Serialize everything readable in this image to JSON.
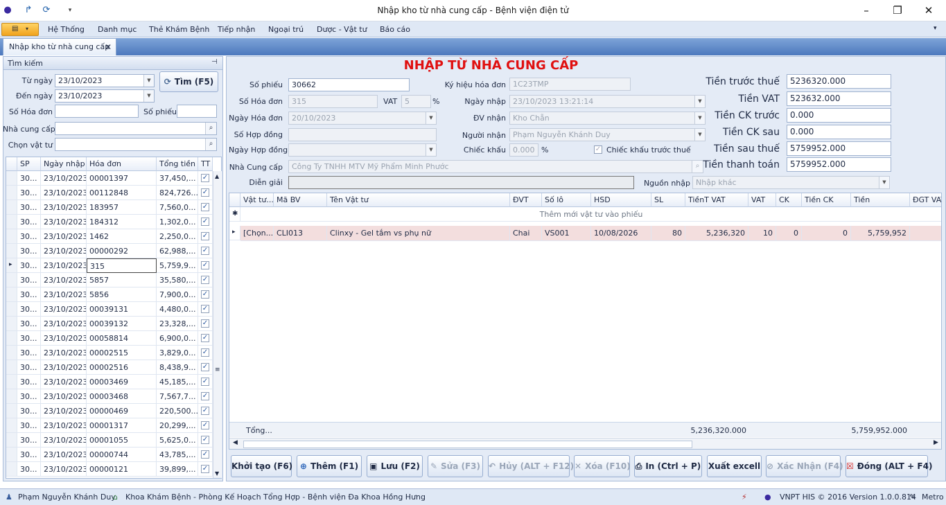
{
  "window": {
    "title": "Nhập kho từ nhà cung cấp - Bệnh viện điện tử"
  },
  "menu": [
    "Hệ Thống",
    "Danh mục",
    "Thẻ Khám Bệnh",
    "Tiếp nhận",
    "Ngoại trú",
    "Dược - Vật tư",
    "Báo cáo"
  ],
  "tab": {
    "label": "Nhập kho từ nhà cung cấp"
  },
  "search": {
    "header": "Tìm kiếm",
    "from_label": "Từ ngày",
    "from_value": "23/10/2023",
    "to_label": "Đến ngày",
    "to_value": "23/10/2023",
    "invoice_label": "Số Hóa đơn",
    "invoice_value": "",
    "slip_label": "Số phiếu",
    "slip_value": "",
    "supplier_label": "Nhà cung cấp",
    "supplier_value": "",
    "material_label": "Chọn vật tư",
    "material_value": "",
    "find_button": "Tìm (F5)"
  },
  "list": {
    "columns": [
      "SP",
      "Ngày nhập",
      "Hóa đơn",
      "Tổng tiền",
      "TT"
    ],
    "rows": [
      {
        "sp": "30...",
        "date": "23/10/2023",
        "invoice": "00001397",
        "total": "37,450,..."
      },
      {
        "sp": "30...",
        "date": "23/10/2023",
        "invoice": "00112848",
        "total": "824,726...."
      },
      {
        "sp": "30...",
        "date": "23/10/2023",
        "invoice": "183957",
        "total": "7,560,0..."
      },
      {
        "sp": "30...",
        "date": "23/10/2023",
        "invoice": "184312",
        "total": "1,302,0..."
      },
      {
        "sp": "30...",
        "date": "23/10/2023",
        "invoice": "1462",
        "total": "2,250,0..."
      },
      {
        "sp": "30...",
        "date": "23/10/2023",
        "invoice": "00000292",
        "total": "62,988,..."
      },
      {
        "sp": "30...",
        "date": "23/10/2023",
        "invoice": "315",
        "total": "5,759,9..."
      },
      {
        "sp": "30...",
        "date": "23/10/2023",
        "invoice": "5857",
        "total": "35,580,..."
      },
      {
        "sp": "30...",
        "date": "23/10/2023",
        "invoice": "5856",
        "total": "7,900,0..."
      },
      {
        "sp": "30...",
        "date": "23/10/2023",
        "invoice": "00039131",
        "total": "4,480,0..."
      },
      {
        "sp": "30...",
        "date": "23/10/2023",
        "invoice": "00039132",
        "total": "23,328,..."
      },
      {
        "sp": "30...",
        "date": "23/10/2023",
        "invoice": "00058814",
        "total": "6,900,0..."
      },
      {
        "sp": "30...",
        "date": "23/10/2023",
        "invoice": "00002515",
        "total": "3,829,0..."
      },
      {
        "sp": "30...",
        "date": "23/10/2023",
        "invoice": "00002516",
        "total": "8,438,9..."
      },
      {
        "sp": "30...",
        "date": "23/10/2023",
        "invoice": "00003469",
        "total": "45,185,..."
      },
      {
        "sp": "30...",
        "date": "23/10/2023",
        "invoice": "00003468",
        "total": "7,567,7..."
      },
      {
        "sp": "30...",
        "date": "23/10/2023",
        "invoice": "00000469",
        "total": "220,500..."
      },
      {
        "sp": "30...",
        "date": "23/10/2023",
        "invoice": "00001317",
        "total": "20,299,..."
      },
      {
        "sp": "30...",
        "date": "23/10/2023",
        "invoice": "00001055",
        "total": "5,625,0..."
      },
      {
        "sp": "30...",
        "date": "23/10/2023",
        "invoice": "00000744",
        "total": "43,785,..."
      },
      {
        "sp": "30...",
        "date": "23/10/2023",
        "invoice": "00000121",
        "total": "39,899,..."
      }
    ]
  },
  "form": {
    "title": "NHẬP TỪ NHÀ CUNG CẤP",
    "slip_label": "Số phiếu",
    "slip_value": "30662",
    "invoice_label": "Số Hóa đơn",
    "invoice_value": "315",
    "vat_label": "VAT",
    "vat_value": "5",
    "vat_unit": "%",
    "invoice_date_label": "Ngày Hóa đơn",
    "invoice_date_value": "20/10/2023",
    "contract_label": "Số Hợp đồng",
    "contract_value": "",
    "contract_date_label": "Ngày Hợp đồng",
    "contract_date_value": "",
    "supplier_label": "Nhà Cung cấp",
    "supplier_value": "Công Ty TNHH MTV Mỹ Phẩm Minh Phước",
    "note_label": "Diễn giải",
    "note_value": "",
    "symbol_label": "Ký hiệu hóa đơn",
    "symbol_value": "1C23TMP",
    "import_date_label": "Ngày nhập",
    "import_date_value": "23/10/2023 13:21:14",
    "dept_label": "ĐV nhận",
    "dept_value": "Kho Chẵn",
    "receiver_label": "Người nhận",
    "receiver_value": "Phạm Nguyễn  Khánh Duy",
    "discount_label": "Chiếc khấu",
    "discount_value": "0.000",
    "discount_unit": "%",
    "discount_before_tax_label": "Chiếc khấu trước thuế",
    "source_label": "Nguồn nhập",
    "source_value": "Nhập khác"
  },
  "summary": {
    "before_tax_label": "Tiền trước thuế",
    "before_tax_value": "5236320.000",
    "vat_label": "Tiền VAT",
    "vat_value": "523632.000",
    "ck_before_label": "Tiền CK trước",
    "ck_before_value": "0.000",
    "ck_after_label": "Tiền CK sau",
    "ck_after_value": "0.000",
    "after_tax_label": "Tiền sau thuế",
    "after_tax_value": "5759952.000",
    "payment_label": "Tiền thanh toán",
    "payment_value": "5759952.000"
  },
  "items": {
    "columns": [
      "Vật tư...",
      "Mã BV",
      "Tên Vật tư",
      "ĐVT",
      "Số lô",
      "HSD",
      "SL",
      "TiềnT  VAT",
      "VAT",
      "CK",
      "Tiền CK",
      "Tiền",
      "ĐGT VAT"
    ],
    "new_row_text": "Thêm mới vật tư vào phiếu",
    "rows": [
      {
        "vt": "[Chọn...",
        "ma": "CLI013",
        "ten": "Clinxy - Gel tắm vs phụ nữ",
        "dvt": "Chai",
        "lo": "VS001",
        "hsd": "10/08/2026",
        "sl": "80",
        "tien_t": "5,236,320",
        "vat": "10",
        "ck": "0",
        "tien_ck": "0",
        "tien": "5,759,952",
        "dgt": ""
      }
    ],
    "footer_label": "Tổng...",
    "footer_tien_t": "5,236,320.000",
    "footer_tien": "5,759,952.000"
  },
  "buttons": {
    "init": "Khởi tạo (F6)",
    "add": "Thêm (F1)",
    "save": "Lưu (F2)",
    "edit": "Sửa (F3)",
    "cancel": "Hủy (ALT + F12)",
    "delete": "Xóa (F10)",
    "print": "In (Ctrl + P)",
    "excel": "Xuất excell",
    "confirm": "Xác Nhận (F4)",
    "close": "Đóng (ALT + F4)"
  },
  "status": {
    "user": "Phạm Nguyễn  Khánh Duy",
    "dept": "Khoa Khám Bệnh - Phòng Kế Hoạch Tổng Hợp - Bệnh viện Đa Khoa Hồng Hưng",
    "version": "VNPT HIS © 2016 Version 1.0.0.814",
    "theme": "Metro"
  },
  "colors": {
    "title_red": "#e01010",
    "selected_row": "#f3dede",
    "accent": "#4c78bd"
  }
}
